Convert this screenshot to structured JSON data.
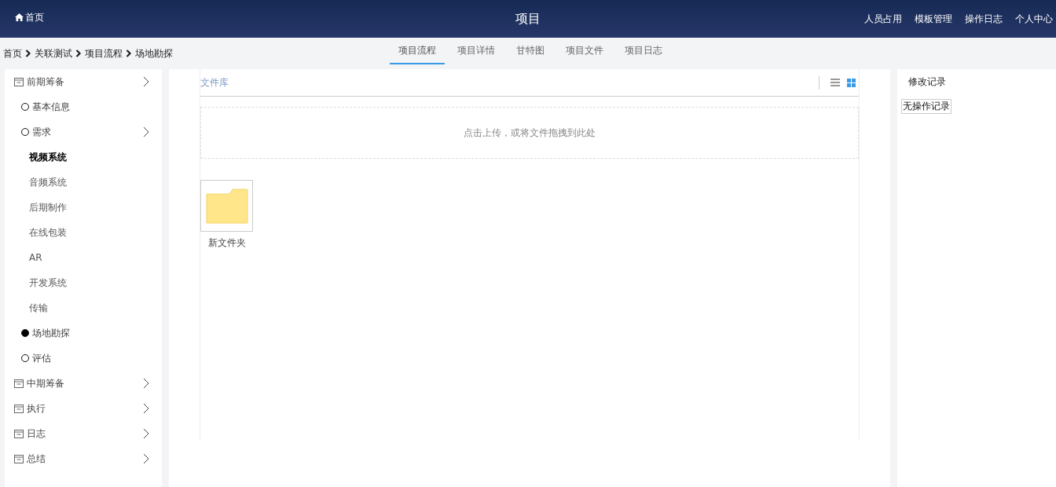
{
  "header": {
    "home": "首页",
    "title": "项目",
    "links": [
      "人员占用",
      "模板管理",
      "操作日志",
      "个人中心"
    ]
  },
  "breadcrumb": [
    "首页",
    "关联测试",
    "项目流程",
    "场地勘探"
  ],
  "tabs": [
    {
      "label": "项目流程",
      "selected": true
    },
    {
      "label": "项目详情",
      "selected": false
    },
    {
      "label": "甘特图",
      "selected": false
    },
    {
      "label": "项目文件",
      "selected": false
    },
    {
      "label": "项目日志",
      "selected": false
    }
  ],
  "sidebar": [
    {
      "label": "前期筹备",
      "expandable": true,
      "children": [
        {
          "label": "基本信息",
          "current": false,
          "expandable": false
        },
        {
          "label": "需求",
          "current": false,
          "expandable": true,
          "children": [
            {
              "label": "视频系统",
              "selected": true
            },
            {
              "label": "音频系统",
              "selected": false
            },
            {
              "label": "后期制作",
              "selected": false
            },
            {
              "label": "在线包装",
              "selected": false
            },
            {
              "label": "AR",
              "selected": false
            },
            {
              "label": "开发系统",
              "selected": false
            },
            {
              "label": "传输",
              "selected": false
            }
          ]
        },
        {
          "label": "场地勘探",
          "current": true,
          "expandable": false
        },
        {
          "label": "评估",
          "current": false,
          "expandable": false
        }
      ]
    },
    {
      "label": "中期筹备",
      "expandable": true
    },
    {
      "label": "执行",
      "expandable": true
    },
    {
      "label": "日志",
      "expandable": true
    },
    {
      "label": "总结",
      "expandable": true
    }
  ],
  "files": {
    "title": "文件库",
    "views": [
      {
        "kind": "list",
        "selected": false
      },
      {
        "kind": "grid",
        "selected": true
      }
    ],
    "upload_hint": "点击上传，或将文件拖拽到此处",
    "items": [
      {
        "name": "新文件夹"
      }
    ]
  },
  "history": {
    "title": "修改记录",
    "empty": "无操作记录"
  }
}
